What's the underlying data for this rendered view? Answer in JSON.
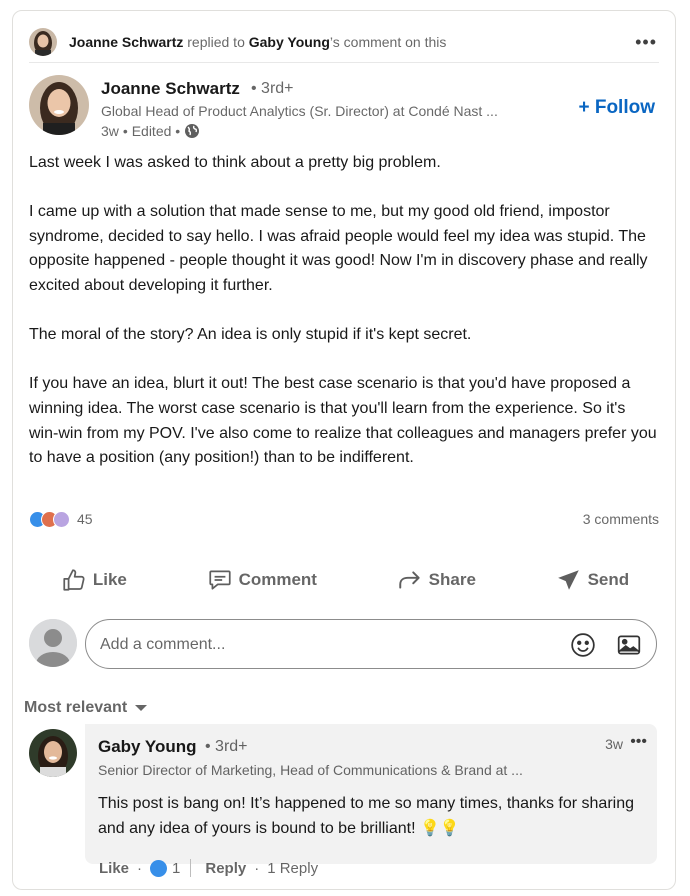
{
  "activity": {
    "actor": "Joanne Schwartz",
    "verb": "replied to",
    "target": "Gaby Young",
    "suffix": "’s comment on this"
  },
  "post": {
    "author_name": "Joanne Schwartz",
    "degree": "• 3rd+",
    "author_title": "Global Head of Product Analytics (Sr. Director) at Condé Nast ...",
    "age": "3w",
    "edited": "• Edited •",
    "follow_label": "+ Follow",
    "body": [
      "Last week I was asked to think about a pretty big problem.",
      "I came up with a solution that made sense to me, but my good old friend, impostor syndrome, decided to say hello. I was afraid people would feel my idea was stupid. The opposite happened - people thought it was good! Now I'm in discovery phase and really excited about developing it further.",
      "The moral of the story? An idea is only stupid if it's kept secret.",
      "If you have an idea, blurt it out! The best case scenario is that you'd have proposed a winning idea. The worst case scenario is that you'll learn from the experience. So it's win-win from my POV. I've also come to realize that colleagues and managers prefer you to have a position (any position!) than to be indifferent."
    ],
    "reaction_count": "45",
    "comments_count": "3 comments"
  },
  "actions": {
    "like": "Like",
    "comment": "Comment",
    "share": "Share",
    "send": "Send"
  },
  "composer": {
    "placeholder": "Add a comment..."
  },
  "sort": {
    "label": "Most relevant"
  },
  "reply": {
    "name": "Gaby Young",
    "degree": "• 3rd+",
    "title": "Senior Director of Marketing, Head of Communications & Brand at ...",
    "time": "3w",
    "text": "This post is bang on! It’s happened to me so many times, thanks for sharing and any idea of yours is bound to be brilliant! 💡💡",
    "like_label": "Like",
    "like_count": "1",
    "reply_label": "Reply",
    "replies": "1 Reply"
  },
  "colors": {
    "accent": "#0a66c2",
    "like_blue": "#378fe9",
    "celebrate": "#df704d",
    "love": "#b9a4e1"
  }
}
